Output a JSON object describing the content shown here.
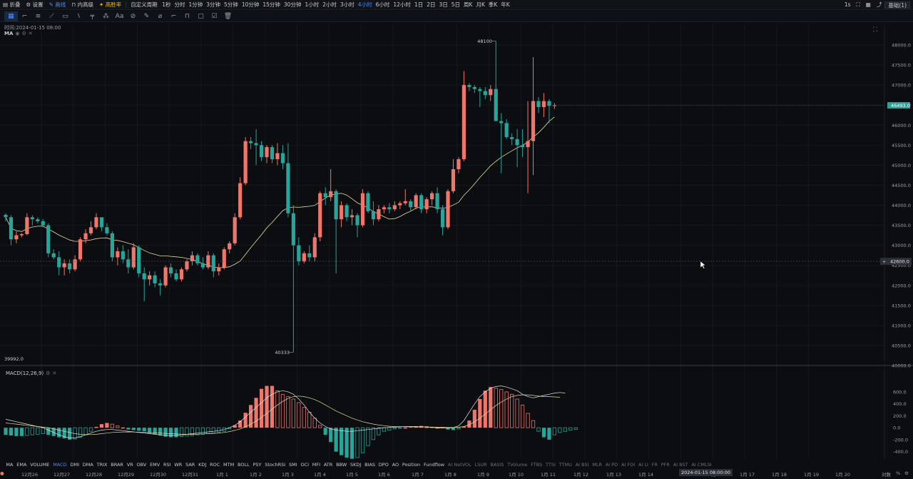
{
  "topbar": {
    "items": [
      {
        "label": "折叠",
        "state": "normal"
      },
      {
        "label": "设置",
        "state": "normal"
      },
      {
        "label": "画线",
        "state": "active"
      },
      {
        "label": "内高级",
        "state": "normal"
      },
      {
        "label": "高胜率",
        "state": "accent"
      }
    ],
    "interval_custom": "自定义周期",
    "intervals": [
      "1秒",
      "分时",
      "1分钟",
      "3分钟",
      "5分钟",
      "10分钟",
      "15分钟",
      "30分钟",
      "1小时",
      "2小时",
      "3小时",
      "4小时",
      "6小时",
      "12小时",
      "1日",
      "2日",
      "3日",
      "5日",
      "周K",
      "月K",
      "季K",
      "年K"
    ],
    "active_interval": "4小时",
    "right_interval": "1s",
    "right_mode": "基础(1)"
  },
  "hud": {
    "time_label": "时间:2024-01-15 08:00",
    "ma_label": "MA",
    "macd_label": "MACD(12,26,9)"
  },
  "price_panel": {
    "yticks": [
      48000,
      47500,
      47000,
      46500,
      46000,
      45500,
      45000,
      44500,
      44000,
      43500,
      43000,
      42500,
      42000,
      41500,
      41000,
      40500,
      40000
    ],
    "ytick_labels": [
      "48000.0",
      "47500.0",
      "47000.0",
      "46500.0",
      "46000.0",
      "45500.0",
      "45000.0",
      "44500.0",
      "44000.0",
      "43500.0",
      "43000.0",
      "42500.0",
      "42000.0",
      "41500.0",
      "41000.0",
      "40500.0",
      "40000.0"
    ],
    "current_price": 46493,
    "current_price_label": "46493.0",
    "crosshair_price": 42600,
    "crosshair_label": "42600.0",
    "high_label": "48100",
    "low_label": "40333",
    "left_low_label": "39992.0"
  },
  "macd_panel": {
    "yticks": [
      600,
      400,
      200,
      0,
      -200,
      -400
    ],
    "ytick_labels": [
      "600.0",
      "400.0",
      "200.0",
      "0.0",
      "-200.0",
      "-400.0"
    ]
  },
  "indicators": [
    "MA",
    "EMA",
    "VOLUME",
    "MACD",
    "DMI",
    "DMA",
    "TRIX",
    "BRAR",
    "VR",
    "OBV",
    "EMV",
    "RSI",
    "WR",
    "SAR",
    "KDJ",
    "ROC",
    "MTM",
    "BOLL",
    "PSY",
    "StochRSI",
    "SMI",
    "OCI",
    "MFI",
    "ATR",
    "BBW",
    "SKDJ",
    "BIAS",
    "DPO",
    "AO",
    "Position",
    "Fundflow",
    "AI NetVOL",
    "LSUR",
    "BASIS",
    "TVolume",
    "FTBS",
    "TTSI",
    "TTMU",
    "AI BSI",
    "MLR",
    "AI PD",
    "AI FOI",
    "AI LI",
    "FR",
    "PFR",
    "AI BST",
    "AI CMLSI"
  ],
  "active_indicator": "MACD",
  "dim_from": "AI NetVOL",
  "timeaxis": {
    "labels": [
      "12月26",
      "12月27",
      "12月28",
      "12月29",
      "12月30",
      "12月31",
      "1月 1",
      "1月 2",
      "1月 3",
      "1月 4",
      "1月 5",
      "1月 6",
      "1月 7",
      "1月 8",
      "1月 9",
      "1月 10",
      "1月 11",
      "1月 12",
      "1月 13",
      "1月 14",
      "1月 16",
      "1月 17",
      "1月 18",
      "1月 19",
      "1月 20"
    ],
    "crosshair_time": "2024-01-15 08:00:00",
    "right_label": "对数",
    "right_label2": "%"
  },
  "colors": {
    "up": "#f0766b",
    "down": "#26a69a",
    "ma": "#e8dba0",
    "bg": "#0b0d10",
    "accent": "#4c8dff"
  },
  "chart_data": {
    "type": "candlestick",
    "interval": "4小时",
    "ylim": [
      40000,
      48000
    ],
    "x": [
      "12-26 00:00",
      "12-26 04:00",
      "12-26 08:00",
      "12-26 12:00",
      "12-26 16:00",
      "12-26 20:00",
      "12-27 00:00",
      "12-27 04:00",
      "12-27 08:00",
      "12-27 12:00",
      "12-27 16:00",
      "12-27 20:00",
      "12-28 00:00",
      "12-28 04:00",
      "12-28 08:00",
      "12-28 12:00",
      "12-28 16:00",
      "12-28 20:00",
      "12-29 00:00",
      "12-29 04:00",
      "12-29 08:00",
      "12-29 12:00",
      "12-29 16:00",
      "12-29 20:00",
      "12-30 00:00",
      "12-30 04:00",
      "12-30 08:00",
      "12-30 12:00",
      "12-30 16:00",
      "12-30 20:00",
      "12-31 00:00",
      "12-31 04:00",
      "12-31 08:00",
      "12-31 12:00",
      "12-31 16:00",
      "12-31 20:00",
      "01-01 00:00",
      "01-01 04:00",
      "01-01 08:00",
      "01-01 12:00",
      "01-01 16:00",
      "01-01 20:00",
      "01-02 00:00",
      "01-02 04:00",
      "01-02 08:00",
      "01-02 12:00",
      "01-02 16:00",
      "01-02 20:00",
      "01-03 00:00",
      "01-03 04:00",
      "01-03 08:00",
      "01-03 12:00",
      "01-03 16:00",
      "01-03 20:00",
      "01-04 00:00",
      "01-04 04:00",
      "01-04 08:00",
      "01-04 12:00",
      "01-04 16:00",
      "01-04 20:00",
      "01-05 00:00",
      "01-05 04:00",
      "01-05 08:00",
      "01-05 12:00",
      "01-05 16:00",
      "01-05 20:00",
      "01-06 00:00",
      "01-06 04:00",
      "01-06 08:00",
      "01-06 12:00",
      "01-06 16:00",
      "01-06 20:00",
      "01-07 00:00",
      "01-07 04:00",
      "01-07 08:00",
      "01-07 12:00",
      "01-07 16:00",
      "01-07 20:00",
      "01-08 00:00",
      "01-08 04:00",
      "01-08 08:00",
      "01-08 12:00",
      "01-08 16:00",
      "01-08 20:00",
      "01-09 00:00",
      "01-09 04:00",
      "01-09 08:00",
      "01-09 12:00",
      "01-09 16:00",
      "01-09 20:00",
      "01-10 00:00",
      "01-10 04:00",
      "01-10 08:00",
      "01-10 12:00",
      "01-10 16:00",
      "01-10 20:00",
      "01-11 00:00",
      "01-11 04:00",
      "01-11 08:00",
      "01-11 12:00",
      "01-11 16:00",
      "01-11 20:00",
      "01-12 00:00",
      "01-12 04:00"
    ],
    "ohlc": [
      [
        43760,
        43800,
        43600,
        43700
      ],
      [
        43700,
        43750,
        43000,
        43150
      ],
      [
        43150,
        43350,
        43050,
        43250
      ],
      [
        43250,
        43300,
        43200,
        43280
      ],
      [
        43280,
        43800,
        43250,
        43700
      ],
      [
        43700,
        43750,
        43500,
        43650
      ],
      [
        43650,
        43700,
        43550,
        43600
      ],
      [
        43600,
        43650,
        43450,
        43500
      ],
      [
        43500,
        43550,
        42700,
        42800
      ],
      [
        42800,
        42900,
        42650,
        42700
      ],
      [
        42700,
        42850,
        42250,
        42450
      ],
      [
        42450,
        42650,
        42250,
        42550
      ],
      [
        42550,
        42650,
        42300,
        42400
      ],
      [
        42400,
        42750,
        42350,
        42650
      ],
      [
        42650,
        43200,
        42600,
        43150
      ],
      [
        43150,
        43400,
        43050,
        43300
      ],
      [
        43300,
        43600,
        43250,
        43450
      ],
      [
        43450,
        43800,
        43400,
        43700
      ],
      [
        43700,
        43700,
        43350,
        43450
      ],
      [
        43450,
        43550,
        43250,
        43300
      ],
      [
        43300,
        43350,
        42600,
        42700
      ],
      [
        42700,
        42950,
        42500,
        42850
      ],
      [
        42850,
        43000,
        42550,
        42650
      ],
      [
        42650,
        42900,
        42300,
        42450
      ],
      [
        42450,
        43050,
        42400,
        42950
      ],
      [
        42950,
        43000,
        42200,
        42300
      ],
      [
        42300,
        42450,
        41600,
        42150
      ],
      [
        42150,
        42350,
        42000,
        42250
      ],
      [
        42250,
        42350,
        41950,
        42050
      ],
      [
        42050,
        42150,
        41750,
        42000
      ],
      [
        42000,
        42500,
        41950,
        42450
      ],
      [
        42450,
        42550,
        42200,
        42300
      ],
      [
        42300,
        42400,
        42100,
        42150
      ],
      [
        42150,
        42450,
        42100,
        42400
      ],
      [
        42400,
        42650,
        42350,
        42600
      ],
      [
        42600,
        42850,
        42500,
        42750
      ],
      [
        42750,
        42800,
        42500,
        42550
      ],
      [
        42550,
        42700,
        42400,
        42450
      ],
      [
        42450,
        42850,
        42400,
        42750
      ],
      [
        42750,
        42800,
        42200,
        42350
      ],
      [
        42350,
        42550,
        42250,
        42450
      ],
      [
        42450,
        42950,
        42400,
        42900
      ],
      [
        42900,
        43100,
        42800,
        43050
      ],
      [
        43050,
        43800,
        43000,
        43700
      ],
      [
        43700,
        44700,
        43650,
        44550
      ],
      [
        44550,
        45700,
        44500,
        45600
      ],
      [
        45600,
        45700,
        45400,
        45550
      ],
      [
        45550,
        45900,
        45000,
        45500
      ],
      [
        45500,
        45600,
        45100,
        45200
      ],
      [
        45200,
        45500,
        45050,
        45450
      ],
      [
        45450,
        45500,
        45050,
        45150
      ],
      [
        45150,
        45550,
        45000,
        45300
      ],
      [
        45300,
        45500,
        44900,
        45050
      ],
      [
        45050,
        45550,
        43700,
        43800
      ],
      [
        43800,
        44000,
        40333,
        43000
      ],
      [
        43000,
        43200,
        42500,
        42600
      ],
      [
        42600,
        42850,
        42550,
        42800
      ],
      [
        42800,
        43000,
        42600,
        42700
      ],
      [
        42700,
        43300,
        42600,
        43200
      ],
      [
        43200,
        44350,
        43100,
        44300
      ],
      [
        44300,
        44450,
        44000,
        44200
      ],
      [
        44200,
        44900,
        44100,
        44350
      ],
      [
        44350,
        44400,
        42300,
        43650
      ],
      [
        43650,
        44100,
        43450,
        44000
      ],
      [
        44000,
        44050,
        43600,
        43700
      ],
      [
        43700,
        43900,
        43500,
        43750
      ],
      [
        43750,
        43800,
        43200,
        43500
      ],
      [
        43500,
        44400,
        43450,
        44300
      ],
      [
        44300,
        44350,
        43800,
        43850
      ],
      [
        43850,
        44100,
        43500,
        43650
      ],
      [
        43650,
        44000,
        43600,
        43900
      ],
      [
        43900,
        44000,
        43800,
        43950
      ],
      [
        43950,
        44050,
        43800,
        43900
      ],
      [
        43900,
        44100,
        43850,
        44000
      ],
      [
        44000,
        44100,
        43900,
        44050
      ],
      [
        44050,
        44400,
        44000,
        44100
      ],
      [
        44100,
        44150,
        43850,
        43950
      ],
      [
        43950,
        44300,
        43900,
        44250
      ],
      [
        44250,
        44300,
        43800,
        43900
      ],
      [
        43900,
        44200,
        43800,
        44150
      ],
      [
        44150,
        44350,
        44000,
        44300
      ],
      [
        44300,
        44450,
        43800,
        43900
      ],
      [
        43900,
        44000,
        43250,
        43450
      ],
      [
        43450,
        44400,
        43400,
        44350
      ],
      [
        44350,
        45150,
        44300,
        44900
      ],
      [
        44900,
        45200,
        44800,
        45150
      ],
      [
        45150,
        47350,
        45100,
        47000
      ],
      [
        47000,
        47050,
        46850,
        46950
      ],
      [
        46950,
        47000,
        46800,
        46900
      ],
      [
        46900,
        46950,
        46450,
        46850
      ],
      [
        46850,
        46950,
        46650,
        46750
      ],
      [
        46750,
        47000,
        46600,
        46900
      ],
      [
        46900,
        48100,
        46850,
        46100
      ],
      [
        46100,
        46300,
        44800,
        46050
      ],
      [
        46050,
        46150,
        45650,
        45700
      ],
      [
        45700,
        45800,
        45500,
        45650
      ],
      [
        45650,
        45900,
        44950,
        45500
      ],
      [
        45500,
        45900,
        45200,
        45450
      ],
      [
        45450,
        46600,
        44300,
        45600
      ],
      [
        45600,
        47700,
        44750,
        46600
      ],
      [
        46600,
        46700,
        46300,
        46450
      ],
      [
        46450,
        46800,
        46200,
        46600
      ],
      [
        46600,
        46650,
        46050,
        46480
      ],
      [
        46480,
        46550,
        46400,
        46493
      ]
    ],
    "ma_label": "MA",
    "macd": {
      "params": "MACD(12,26,9)",
      "ylim": [
        -500,
        850
      ],
      "hist": [
        -120,
        -130,
        -140,
        -140,
        -130,
        -120,
        -110,
        -100,
        -120,
        -140,
        -160,
        -180,
        -200,
        -190,
        -160,
        -120,
        -60,
        10,
        60,
        80,
        60,
        30,
        0,
        -30,
        -40,
        -50,
        -60,
        -90,
        -110,
        -130,
        -150,
        -160,
        -160,
        -150,
        -140,
        -130,
        -120,
        -110,
        -100,
        -90,
        -80,
        -60,
        -20,
        40,
        120,
        250,
        380,
        500,
        650,
        700,
        700,
        620,
        560,
        520,
        480,
        420,
        340,
        260,
        160,
        40,
        -120,
        -240,
        -400,
        -460,
        -500,
        -520,
        -500,
        -420,
        -300,
        -200,
        -120,
        -60,
        -40,
        -20,
        -10,
        0,
        10,
        20,
        30,
        20,
        10,
        0,
        -10,
        -30,
        -40,
        -20,
        20,
        120,
        300,
        480,
        620,
        680,
        660,
        640,
        600,
        560,
        480,
        380,
        240,
        120,
        -60,
        -160,
        -200,
        -120,
        -80,
        -60,
        -40,
        -30
      ],
      "dif": [
        140,
        120,
        100,
        80,
        60,
        40,
        20,
        0,
        -40,
        -80,
        -120,
        -150,
        -170,
        -170,
        -150,
        -120,
        -90,
        -60,
        -40,
        -30,
        -30,
        -40,
        -50,
        -60,
        -70,
        -80,
        -90,
        -100,
        -110,
        -120,
        -130,
        -130,
        -130,
        -120,
        -110,
        -100,
        -90,
        -80,
        -70,
        -60,
        -50,
        -30,
        0,
        40,
        100,
        180,
        260,
        340,
        420,
        500,
        560,
        600,
        620,
        600,
        560,
        480,
        380,
        260,
        160,
        80,
        20,
        -20,
        -40,
        -50,
        -60,
        -60,
        -50,
        -40,
        -30,
        -20,
        -10,
        0,
        5,
        10,
        15,
        20,
        20,
        20,
        15,
        10,
        5,
        0,
        -5,
        -5,
        0,
        30,
        120,
        260,
        400,
        520,
        600,
        660,
        690,
        700,
        680,
        650,
        620,
        560,
        520,
        500,
        520,
        540,
        560,
        580,
        590,
        580
      ],
      "dea": [
        80,
        70,
        60,
        50,
        40,
        30,
        20,
        10,
        0,
        -20,
        -40,
        -60,
        -80,
        -100,
        -110,
        -115,
        -115,
        -110,
        -100,
        -90,
        -80,
        -75,
        -72,
        -70,
        -72,
        -75,
        -78,
        -82,
        -86,
        -90,
        -95,
        -100,
        -105,
        -108,
        -110,
        -110,
        -108,
        -104,
        -100,
        -95,
        -90,
        -80,
        -65,
        -45,
        -20,
        15,
        60,
        110,
        170,
        240,
        310,
        380,
        440,
        490,
        520,
        530,
        520,
        500,
        470,
        430,
        380,
        330,
        280,
        240,
        200,
        160,
        130,
        100,
        80,
        60,
        45,
        35,
        25,
        20,
        18,
        16,
        15,
        14,
        13,
        12,
        10,
        8,
        6,
        4,
        4,
        8,
        20,
        50,
        100,
        160,
        230,
        300,
        370,
        430,
        480,
        520,
        540,
        550,
        550,
        540,
        530,
        520,
        520,
        515,
        510
      ]
    }
  }
}
